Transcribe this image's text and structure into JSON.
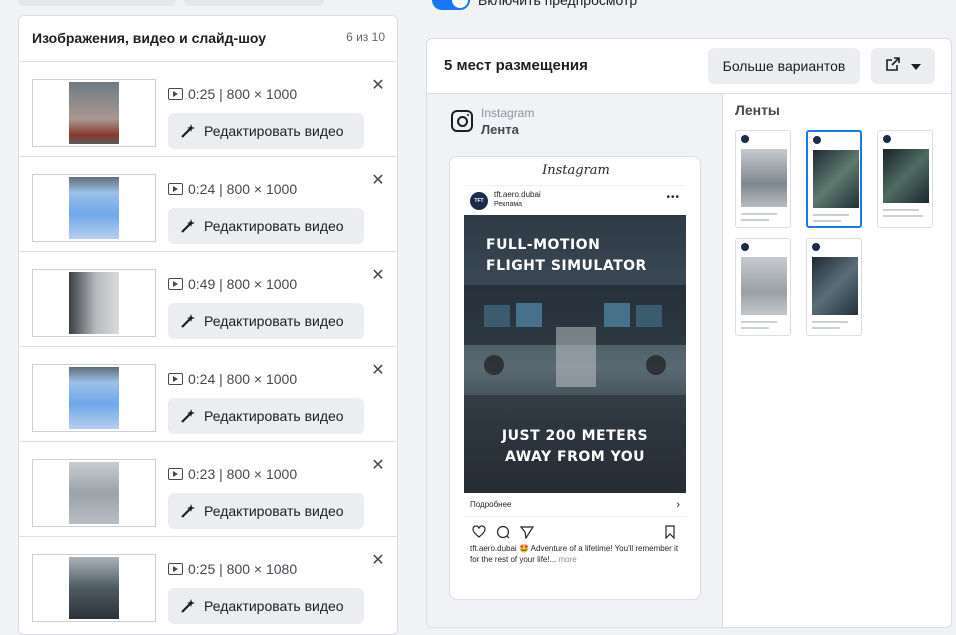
{
  "left": {
    "title": "Изображения, видео и слайд-шоу",
    "count": "6 из 10",
    "items": [
      {
        "meta": "0:25 | 800 × 1000",
        "edit": "Редактировать видео"
      },
      {
        "meta": "0:24 | 800 × 1000",
        "edit": "Редактировать видео"
      },
      {
        "meta": "0:49 | 800 × 1000",
        "edit": "Редактировать видео"
      },
      {
        "meta": "0:24 | 800 × 1000",
        "edit": "Редактировать видео"
      },
      {
        "meta": "0:23 | 800 × 1000",
        "edit": "Редактировать видео"
      },
      {
        "meta": "0:25 | 800 × 1080",
        "edit": "Редактировать видео"
      }
    ]
  },
  "preview_toggle": "Включить предпросмотр",
  "right": {
    "title": "5 мест размещения",
    "more_button": "Больше вариантов",
    "placement": {
      "network": "Instagram",
      "position": "Лента"
    },
    "feeds_title": "Ленты",
    "post": {
      "brand": "Instagram",
      "account": "tft.aero.dubai",
      "sponsored": "Реклама",
      "headline_1": "FULL-MOTION",
      "headline_2": "FLIGHT SIMULATOR",
      "footer_1": "JUST 200 METERS",
      "footer_2": "AWAY FROM YOU",
      "cta": "Подробнее",
      "caption_account": "tft.aero.dubai",
      "caption_text": "🤩 Adventure of a lifetime! You'll remember it for the rest of your life!...",
      "caption_more": "more"
    }
  },
  "colors": {
    "accent": "#1877f2",
    "panel_bg": "#f0f2f5"
  }
}
